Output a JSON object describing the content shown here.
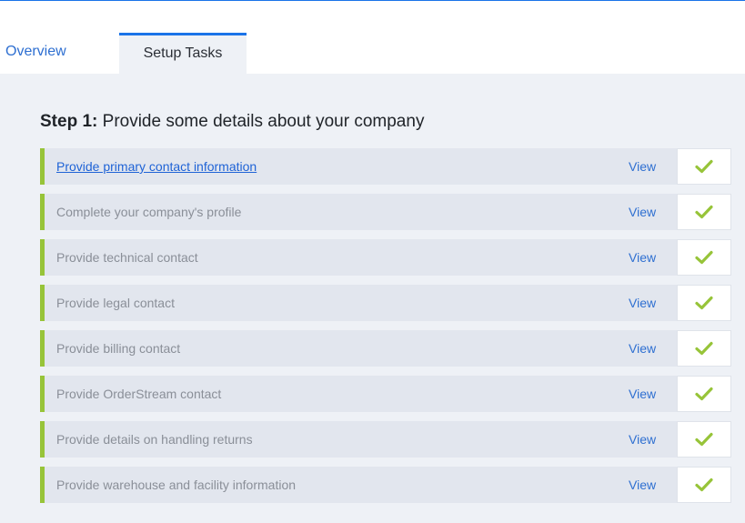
{
  "tabs": [
    {
      "label": "Overview",
      "active": false
    },
    {
      "label": "Setup Tasks",
      "active": true
    }
  ],
  "step": {
    "prefix": "Step 1:",
    "title": "Provide some details about your company"
  },
  "tasks": [
    {
      "label": "Provide primary contact information",
      "view": "View",
      "status_icon": "check-icon"
    },
    {
      "label": "Complete your company's profile",
      "view": "View",
      "status_icon": "check-icon"
    },
    {
      "label": "Provide technical contact",
      "view": "View",
      "status_icon": "check-icon"
    },
    {
      "label": "Provide legal contact",
      "view": "View",
      "status_icon": "check-icon"
    },
    {
      "label": "Provide billing contact",
      "view": "View",
      "status_icon": "check-icon"
    },
    {
      "label": "Provide OrderStream contact",
      "view": "View",
      "status_icon": "check-icon"
    },
    {
      "label": "Provide details on handling returns",
      "view": "View",
      "status_icon": "check-icon"
    },
    {
      "label": "Provide warehouse and facility information",
      "view": "View",
      "status_icon": "check-icon"
    }
  ],
  "colors": {
    "accent": "#1a73e8",
    "link": "#2e6fd1",
    "complete": "#97c439",
    "panel_bg": "#eef1f6",
    "row_bg": "#e2e6ee"
  }
}
